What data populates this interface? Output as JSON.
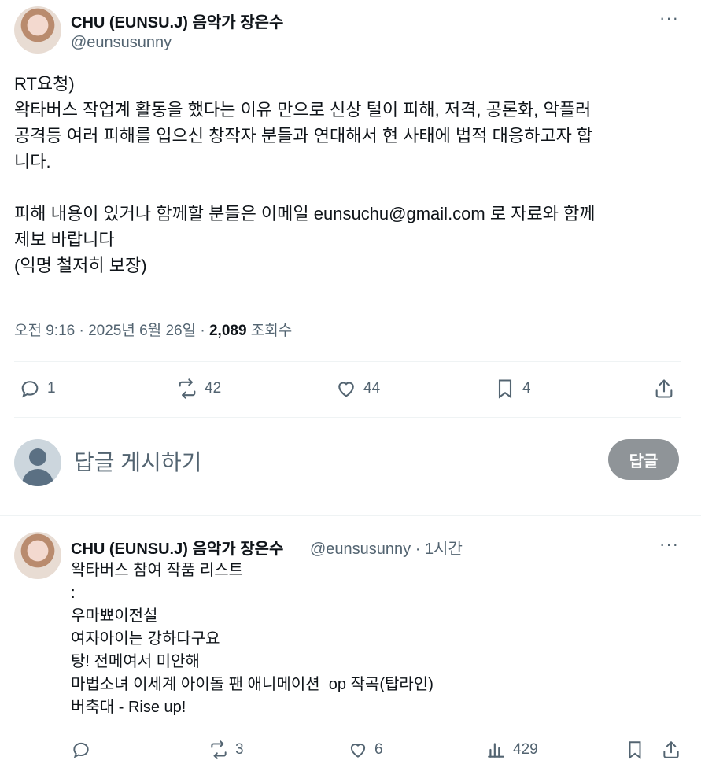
{
  "tweet": {
    "author_name": "CHU (EUNSU.J) 음악가 장은수",
    "handle": "@eunsusunny",
    "more": "···",
    "text": "RT요청)\n왁타버스 작업계 활동을 했다는 이유 만으로 신상 털이 피해, 저격, 공론화, 악플러\n공격등 여러 피해를 입으신 창작자 분들과 연대해서 현 사태에 법적 대응하고자 합\n니다.\n\n피해 내용이 있거나 함께할 분들은 이메일 eunsuchu@gmail.com 로 자료와 함께\n제보 바랍니다\n(익명 철저히 보장)",
    "time": "오전 9:16 · 2025년 6월 26일 · ",
    "views_count": "2,089",
    "views_label": " 조회수",
    "actions": {
      "reply_count": "1",
      "retweet_count": "42",
      "like_count": "44",
      "bookmark_count": "4"
    }
  },
  "compose": {
    "placeholder": "답글 게시하기",
    "button": "답글"
  },
  "reply": {
    "author_name": "CHU (EUNSU.J) 음악가 장은수",
    "handle_time": "@eunsusunny · 1시간",
    "more": "···",
    "text": "왁타버스 참여 작품 리스트\n:\n우마뾰이전설\n여자아이는 강하다구요\n탕! 전메여서 미안해\n마법소녀 이세계 아이돌 팬 애니메이션  op 작곡(탑라인)\n버축대 - Rise up!",
    "actions": {
      "reply_count": "",
      "retweet_count": "3",
      "like_count": "6",
      "views_count": "429"
    }
  }
}
